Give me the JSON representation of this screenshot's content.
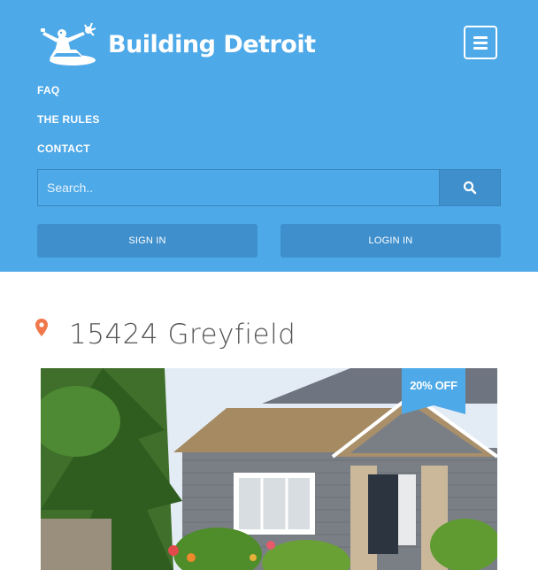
{
  "header": {
    "logo_text": "Building Detroit",
    "menu_icon": "hamburger-icon"
  },
  "nav": {
    "items": [
      {
        "label": "FAQ"
      },
      {
        "label": "THE RULES"
      },
      {
        "label": "CONTACT"
      }
    ]
  },
  "search": {
    "placeholder": "Search..",
    "value": "",
    "icon": "search-icon"
  },
  "auth": {
    "sign_in_label": "SIGN IN",
    "login_label": "LOGIN IN"
  },
  "listing": {
    "pin_icon": "map-pin-icon",
    "address": "15424 Greyfield",
    "badge": "20% OFF",
    "photo": "house-photo"
  },
  "colors": {
    "header_bg": "#4ea9e8",
    "button_bg": "#3f8fcc",
    "pin": "#f0784a"
  }
}
